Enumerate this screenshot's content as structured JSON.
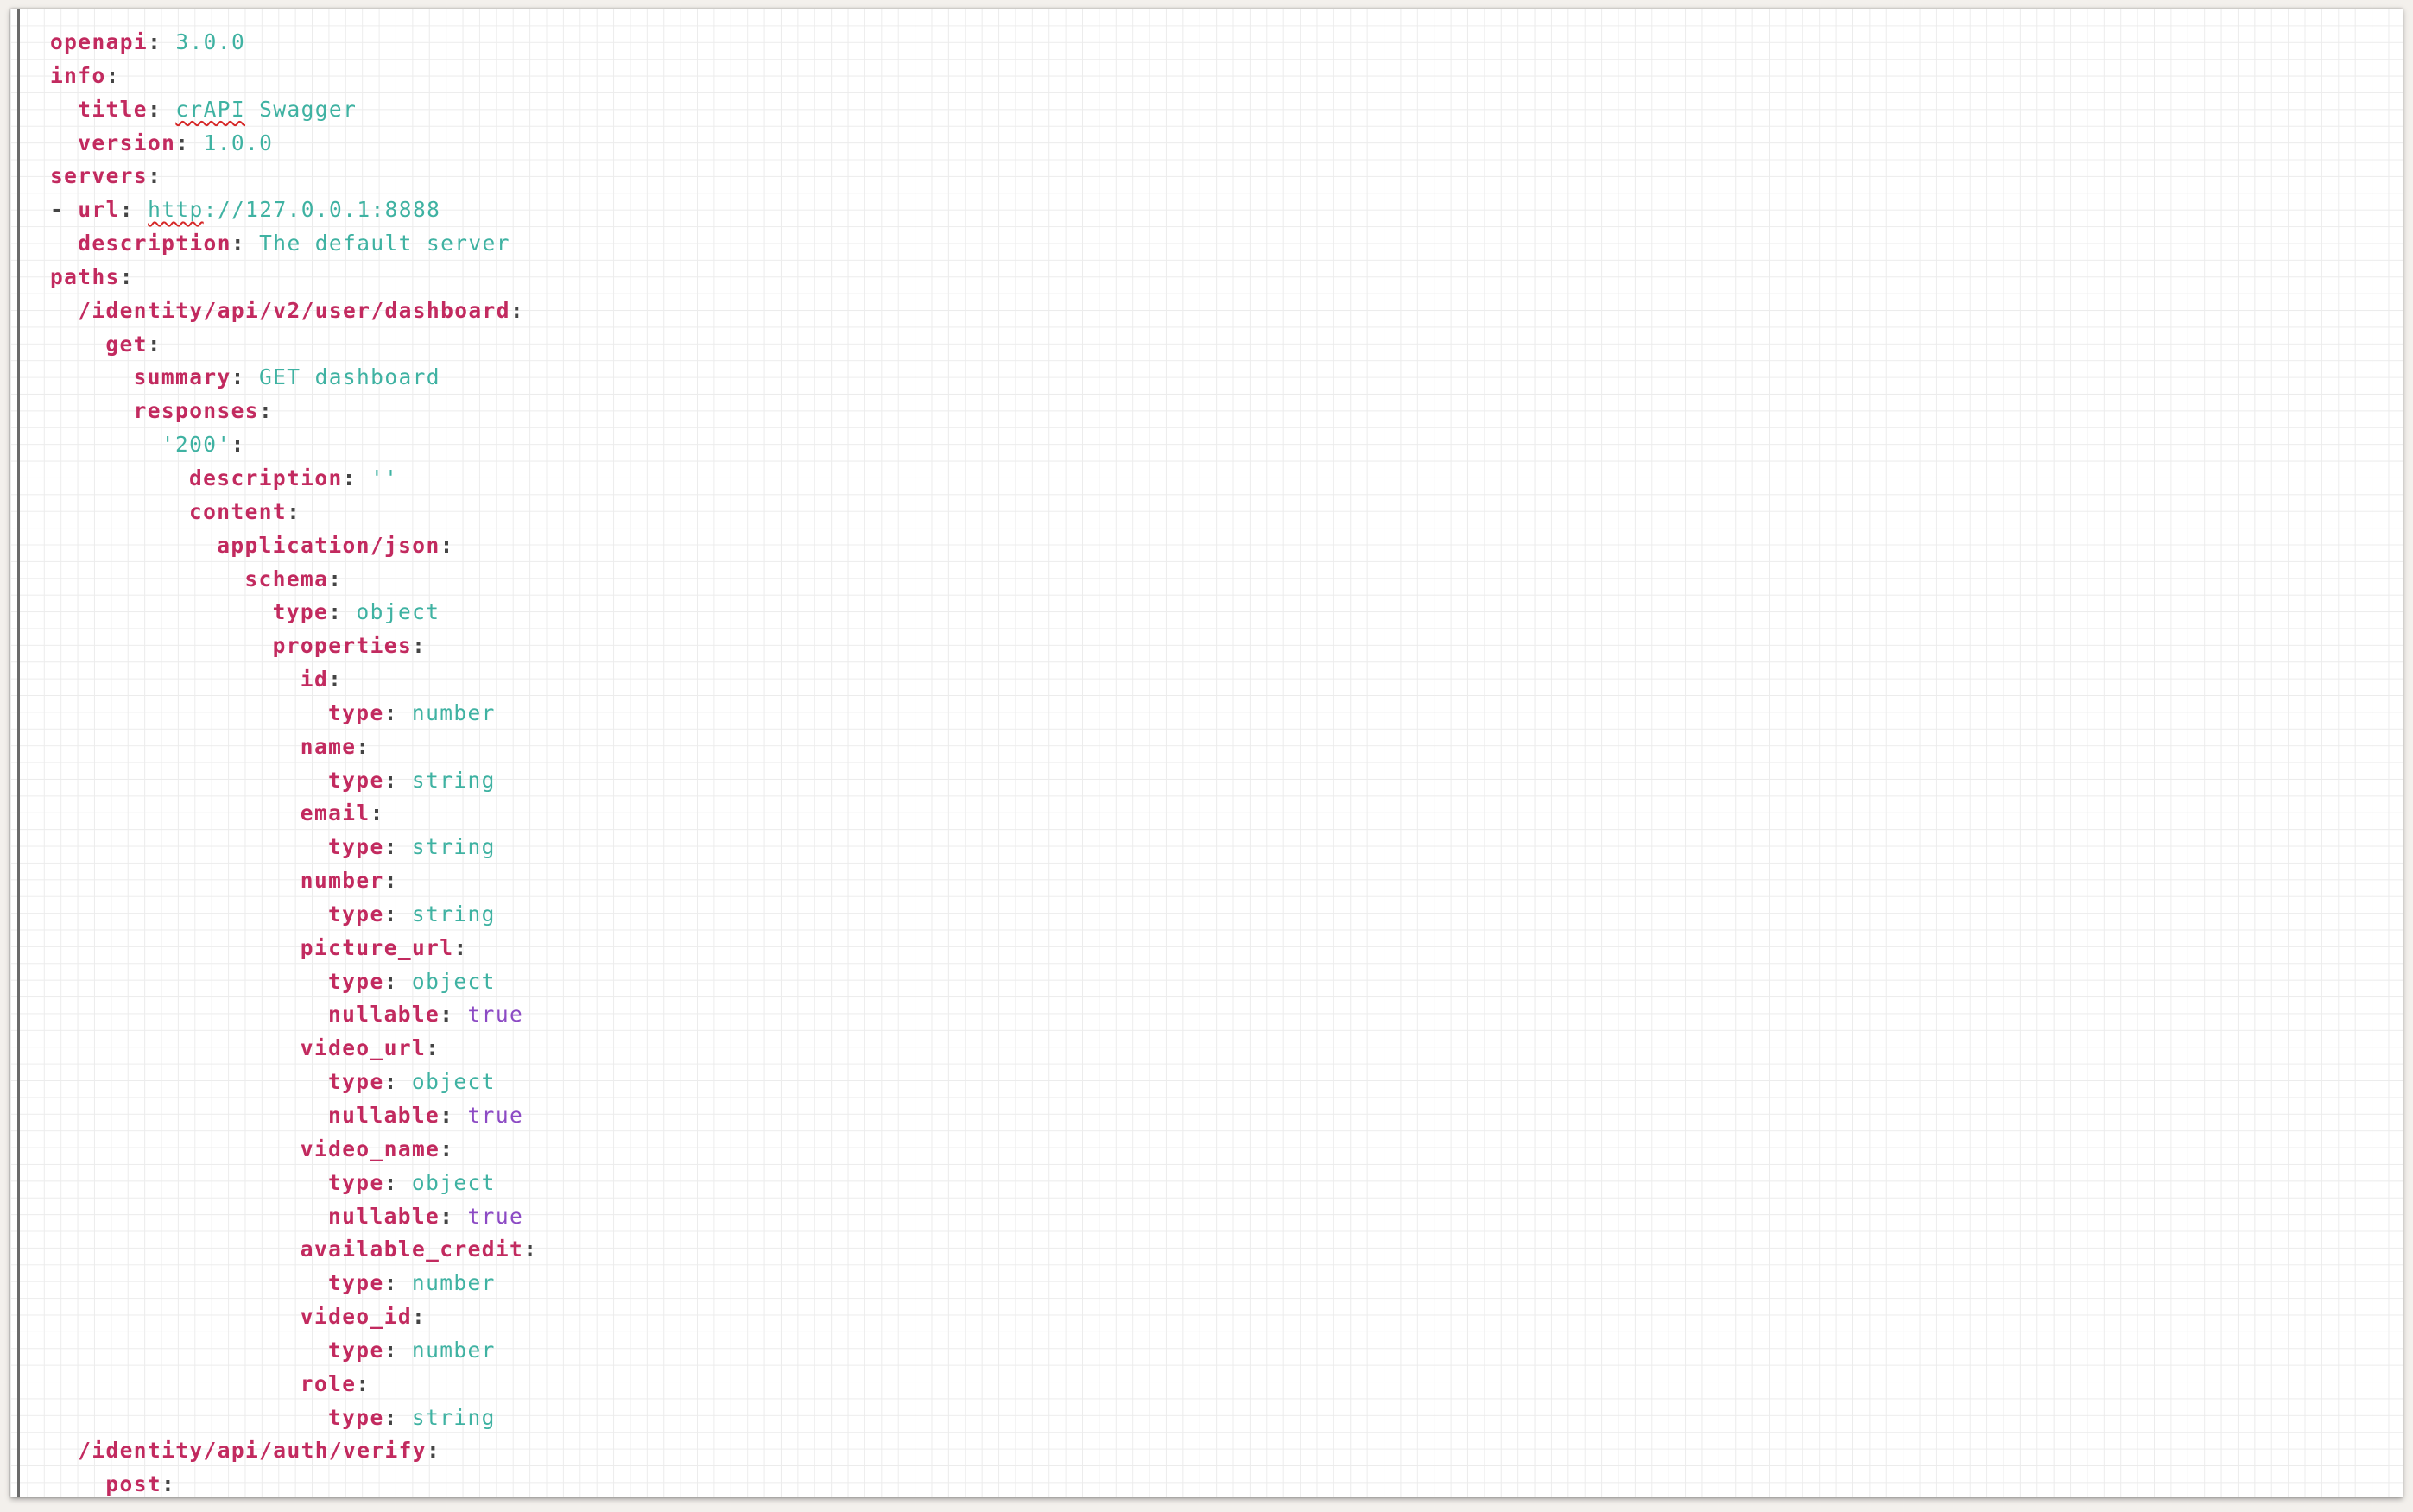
{
  "editor": {
    "lines": [
      {
        "indent": 0,
        "dash": false,
        "key": "openapi",
        "colon": ":",
        "value": "3.0.0",
        "vtype": "str"
      },
      {
        "indent": 0,
        "dash": false,
        "key": "info",
        "colon": ":",
        "value": "",
        "vtype": "str"
      },
      {
        "indent": 1,
        "dash": false,
        "key": "title",
        "colon": ":",
        "value": "crAPI Swagger",
        "vtype": "str",
        "spell": "crAPI"
      },
      {
        "indent": 1,
        "dash": false,
        "key": "version",
        "colon": ":",
        "value": "1.0.0",
        "vtype": "str"
      },
      {
        "indent": 0,
        "dash": false,
        "key": "servers",
        "colon": ":",
        "value": "",
        "vtype": "str"
      },
      {
        "indent": 0,
        "dash": true,
        "key": "url",
        "colon": ":",
        "value": "http://127.0.0.1:8888",
        "vtype": "str",
        "spell": "http"
      },
      {
        "indent": 1,
        "dash": false,
        "key": "description",
        "colon": ":",
        "value": "The default server",
        "vtype": "str"
      },
      {
        "indent": 0,
        "dash": false,
        "key": "paths",
        "colon": ":",
        "value": "",
        "vtype": "str"
      },
      {
        "indent": 1,
        "dash": false,
        "key": "/identity/api/v2/user/dashboard",
        "colon": ":",
        "value": "",
        "vtype": "str"
      },
      {
        "indent": 2,
        "dash": false,
        "key": "get",
        "colon": ":",
        "value": "",
        "vtype": "str"
      },
      {
        "indent": 3,
        "dash": false,
        "key": "summary",
        "colon": ":",
        "value": "GET dashboard",
        "vtype": "str"
      },
      {
        "indent": 3,
        "dash": false,
        "key": "responses",
        "colon": ":",
        "value": "",
        "vtype": "str"
      },
      {
        "indent": 4,
        "dash": false,
        "key": "'200'",
        "colon": ":",
        "value": "",
        "vtype": "strkey"
      },
      {
        "indent": 5,
        "dash": false,
        "key": "description",
        "colon": ":",
        "value": "''",
        "vtype": "str"
      },
      {
        "indent": 5,
        "dash": false,
        "key": "content",
        "colon": ":",
        "value": "",
        "vtype": "str"
      },
      {
        "indent": 6,
        "dash": false,
        "key": "application/json",
        "colon": ":",
        "value": "",
        "vtype": "str"
      },
      {
        "indent": 7,
        "dash": false,
        "key": "schema",
        "colon": ":",
        "value": "",
        "vtype": "str"
      },
      {
        "indent": 8,
        "dash": false,
        "key": "type",
        "colon": ":",
        "value": "object",
        "vtype": "str"
      },
      {
        "indent": 8,
        "dash": false,
        "key": "properties",
        "colon": ":",
        "value": "",
        "vtype": "str"
      },
      {
        "indent": 9,
        "dash": false,
        "key": "id",
        "colon": ":",
        "value": "",
        "vtype": "str"
      },
      {
        "indent": 10,
        "dash": false,
        "key": "type",
        "colon": ":",
        "value": "number",
        "vtype": "str"
      },
      {
        "indent": 9,
        "dash": false,
        "key": "name",
        "colon": ":",
        "value": "",
        "vtype": "str"
      },
      {
        "indent": 10,
        "dash": false,
        "key": "type",
        "colon": ":",
        "value": "string",
        "vtype": "str"
      },
      {
        "indent": 9,
        "dash": false,
        "key": "email",
        "colon": ":",
        "value": "",
        "vtype": "str"
      },
      {
        "indent": 10,
        "dash": false,
        "key": "type",
        "colon": ":",
        "value": "string",
        "vtype": "str"
      },
      {
        "indent": 9,
        "dash": false,
        "key": "number",
        "colon": ":",
        "value": "",
        "vtype": "str"
      },
      {
        "indent": 10,
        "dash": false,
        "key": "type",
        "colon": ":",
        "value": "string",
        "vtype": "str"
      },
      {
        "indent": 9,
        "dash": false,
        "key": "picture_url",
        "colon": ":",
        "value": "",
        "vtype": "str"
      },
      {
        "indent": 10,
        "dash": false,
        "key": "type",
        "colon": ":",
        "value": "object",
        "vtype": "str"
      },
      {
        "indent": 10,
        "dash": false,
        "key": "nullable",
        "colon": ":",
        "value": "true",
        "vtype": "bool"
      },
      {
        "indent": 9,
        "dash": false,
        "key": "video_url",
        "colon": ":",
        "value": "",
        "vtype": "str"
      },
      {
        "indent": 10,
        "dash": false,
        "key": "type",
        "colon": ":",
        "value": "object",
        "vtype": "str"
      },
      {
        "indent": 10,
        "dash": false,
        "key": "nullable",
        "colon": ":",
        "value": "true",
        "vtype": "bool"
      },
      {
        "indent": 9,
        "dash": false,
        "key": "video_name",
        "colon": ":",
        "value": "",
        "vtype": "str"
      },
      {
        "indent": 10,
        "dash": false,
        "key": "type",
        "colon": ":",
        "value": "object",
        "vtype": "str"
      },
      {
        "indent": 10,
        "dash": false,
        "key": "nullable",
        "colon": ":",
        "value": "true",
        "vtype": "bool"
      },
      {
        "indent": 9,
        "dash": false,
        "key": "available_credit",
        "colon": ":",
        "value": "",
        "vtype": "str"
      },
      {
        "indent": 10,
        "dash": false,
        "key": "type",
        "colon": ":",
        "value": "number",
        "vtype": "str"
      },
      {
        "indent": 9,
        "dash": false,
        "key": "video_id",
        "colon": ":",
        "value": "",
        "vtype": "str"
      },
      {
        "indent": 10,
        "dash": false,
        "key": "type",
        "colon": ":",
        "value": "number",
        "vtype": "str"
      },
      {
        "indent": 9,
        "dash": false,
        "key": "role",
        "colon": ":",
        "value": "",
        "vtype": "str"
      },
      {
        "indent": 10,
        "dash": false,
        "key": "type",
        "colon": ":",
        "value": "string",
        "vtype": "str"
      },
      {
        "indent": 1,
        "dash": false,
        "key": "/identity/api/auth/verify",
        "colon": ":",
        "value": "",
        "vtype": "str"
      },
      {
        "indent": 2,
        "dash": false,
        "key": "post",
        "colon": ":",
        "value": "",
        "vtype": "str"
      }
    ]
  },
  "colors": {
    "key": "#c22a5f",
    "string_value": "#3fb2a2",
    "boolean_value": "#8c4ac4",
    "spellcheck_underline": "#d62828"
  }
}
